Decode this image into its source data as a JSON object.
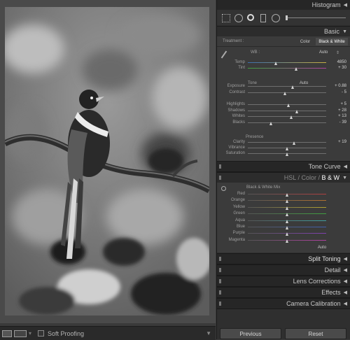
{
  "toolbar": {
    "soft_proofing": "Soft Proofing"
  },
  "sections": {
    "histogram": "Histogram",
    "basic": "Basic",
    "tone_curve": "Tone Curve",
    "hsl": {
      "hsl": "HSL",
      "sep1": "/",
      "color": "Color",
      "sep2": "/",
      "bw": "B & W"
    },
    "split_toning": "Split Toning",
    "detail": "Detail",
    "lens_corrections": "Lens Corrections",
    "effects": "Effects",
    "camera_calibration": "Camera Calibration"
  },
  "basic": {
    "treatment_label": "Treatment :",
    "treatment_color": "Color",
    "treatment_bw": "Black & White",
    "wb_label": "WB :",
    "wb_value": "Auto",
    "tone_label": "Tone",
    "tone_auto": "Auto",
    "presence_label": "Presence",
    "sliders": [
      {
        "label": "Temp",
        "value": "4850",
        "pos": 0.36
      },
      {
        "label": "Tint",
        "value": "+ 30",
        "pos": 0.62
      },
      {
        "label": "Exposure",
        "value": "+ 0.88",
        "pos": 0.58
      },
      {
        "label": "Contrast",
        "value": "- 5",
        "pos": 0.48
      },
      {
        "label": "Highlights",
        "value": "+ 5",
        "pos": 0.52
      },
      {
        "label": "Shadows",
        "value": "+ 28",
        "pos": 0.63
      },
      {
        "label": "Whites",
        "value": "+ 13",
        "pos": 0.56
      },
      {
        "label": "Blacks",
        "value": "- 39",
        "pos": 0.3
      },
      {
        "label": "Clarity",
        "value": "+ 19",
        "pos": 0.59
      },
      {
        "label": "Vibrance",
        "value": "",
        "pos": 0.5
      },
      {
        "label": "Saturation",
        "value": "",
        "pos": 0.5
      }
    ]
  },
  "bw_mix": {
    "title": "Black & White Mix",
    "auto": "Auto",
    "sliders": [
      {
        "label": "Red",
        "pos": 0.5,
        "color": "#b04040"
      },
      {
        "label": "Orange",
        "pos": 0.5,
        "color": "#b07030"
      },
      {
        "label": "Yellow",
        "pos": 0.5,
        "color": "#b0a030"
      },
      {
        "label": "Green",
        "pos": 0.5,
        "color": "#40a040"
      },
      {
        "label": "Aqua",
        "pos": 0.5,
        "color": "#40a0a0"
      },
      {
        "label": "Blue",
        "pos": 0.5,
        "color": "#4060b0"
      },
      {
        "label": "Purple",
        "pos": 0.5,
        "color": "#8040b0"
      },
      {
        "label": "Magenta",
        "pos": 0.5,
        "color": "#b040a0"
      }
    ]
  },
  "buttons": {
    "previous": "Previous",
    "reset": "Reset"
  }
}
